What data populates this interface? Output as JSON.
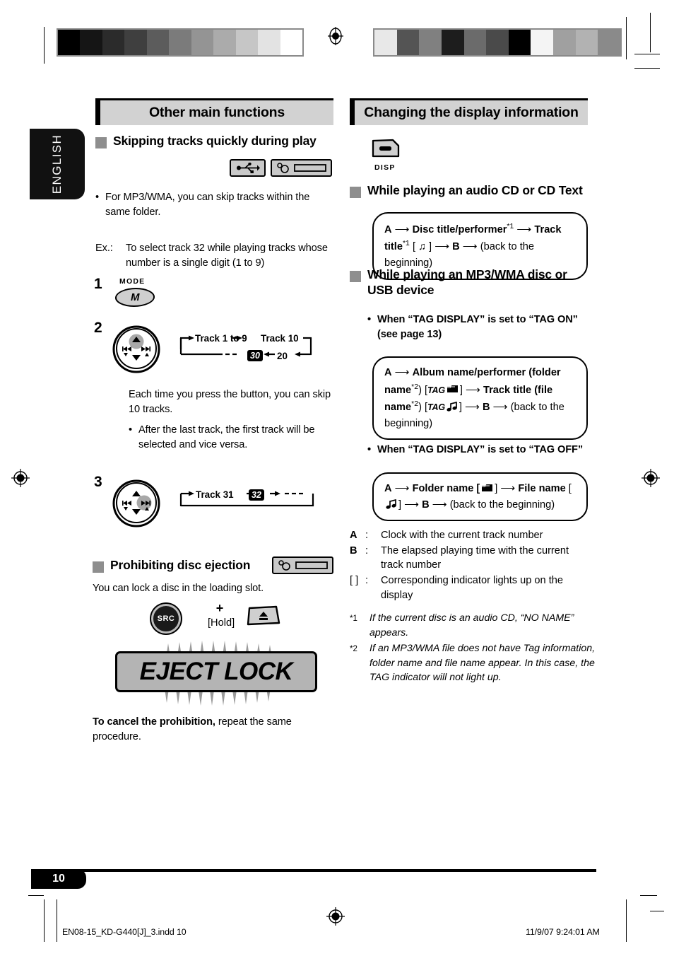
{
  "page": {
    "language_tab": "ENGLISH",
    "page_number": "10",
    "imprint_left": "EN08-15_KD-G440[J]_3.indd   10",
    "imprint_right": "11/9/07   9:24:01 AM"
  },
  "left_column": {
    "header": "Other main functions",
    "section1": {
      "title": "Skipping tracks quickly during play",
      "icons": [
        "usb-icon",
        "faceplate-icon"
      ],
      "bullet": "For MP3/WMA, you can skip tracks within the same folder.",
      "example_label": "Ex.:",
      "example_text": "To select track 32 while playing tracks whose number is a single digit (1 to 9)",
      "steps": [
        {
          "num": "1",
          "button_label": "MODE",
          "button_text": "M"
        },
        {
          "num": "2",
          "flow": {
            "a": "Track 1 to 9",
            "b": "Track 10",
            "c": "20",
            "d": "30"
          },
          "note": "Each time you press the button, you can skip 10 tracks.",
          "sub_bullet": "After the last track, the first track will be selected and vice versa."
        },
        {
          "num": "3",
          "flow": {
            "a": "Track 31",
            "b": "32"
          }
        }
      ]
    },
    "section2": {
      "title": "Prohibiting disc ejection",
      "icons": [
        "faceplate-icon"
      ],
      "intro": "You can lock a disc in the loading slot.",
      "combo": {
        "button1": "SRC",
        "plus": "+",
        "hold": "[Hold]",
        "button2": "eject-icon"
      },
      "display_banner": "EJECT LOCK",
      "cancel_bold": "To cancel the prohibition,",
      "cancel_rest": " repeat the same procedure."
    }
  },
  "right_column": {
    "header": "Changing the display information",
    "disp_button_label": "DISP",
    "section1": {
      "title": "While playing an audio CD or CD Text",
      "flow_line1_a": "A",
      "flow_line1_b": "Disc title/performer",
      "flow_line1_sup": "*1",
      "flow_line1_c": "Track",
      "flow_line2_a": "title",
      "flow_line2_sup": "*1",
      "flow_line2_bracket": "[ ♫ ]",
      "flow_line2_b": "B",
      "flow_line2_c": "(back to the beginning)"
    },
    "section2": {
      "title": "While playing an MP3/WMA disc or USB device",
      "bullet_on": "When “TAG DISPLAY” is set to “TAG ON” (see page 13)",
      "box_on": {
        "l1a": "A",
        "l1b": "Album name/performer (folder",
        "l2a": "name",
        "l2sup": "*2",
        "l2b": ") [",
        "l2tag": "TAG",
        "l2folder": "folder-icon",
        "l2c": "] ",
        "l2d": "Track title (file",
        "l3a": "name",
        "l3sup": "*2",
        "l3b": ") [",
        "l3tag": "TAG",
        "l3note": "note-icon",
        "l3c": "] ",
        "l3d": "B",
        "l3e": "(back to the",
        "l4": "beginning)"
      },
      "bullet_off": "When “TAG DISPLAY” is set to “TAG OFF”",
      "box_off": {
        "l1a": "A",
        "l1b": "Folder name [",
        "l1icon": "folder-icon",
        "l1c": "] ",
        "l1d": "File name",
        "l2a": "[",
        "l2icon": "note-icon",
        "l2b": "] ",
        "l2c": "B",
        "l2d": "(back to the beginning)"
      }
    },
    "definitions": [
      {
        "key": "A",
        "colon": ":",
        "value": "Clock with the current track number"
      },
      {
        "key": "B",
        "colon": ":",
        "value": "The elapsed playing time with the current track number"
      },
      {
        "key": "[  ]",
        "colon": ":",
        "value": "Corresponding indicator lights up on the display"
      }
    ],
    "footnotes": [
      {
        "mark": "*1",
        "text": "If the current disc is an audio CD, “NO NAME” appears."
      },
      {
        "mark": "*2",
        "text": "If an MP3/WMA file does not have Tag information, folder name and file name appear. In this case, the TAG indicator will not light up."
      }
    ]
  },
  "calibration": {
    "bar_left": [
      "#000000",
      "#151515",
      "#2b2b2b",
      "#3f3f3f",
      "#5c5c5c",
      "#7b7b7b",
      "#949494",
      "#ababab",
      "#c6c6c6",
      "#e3e3e3",
      "#ffffff"
    ],
    "bar_right": [
      "#e8e8e8",
      "#545454",
      "#808080",
      "#1d1d1d",
      "#6b6b6b",
      "#4a4a4a",
      "#000000",
      "#f4f4f4",
      "#a0a0a0",
      "#b2b2b2",
      "#8a8a8a"
    ]
  }
}
